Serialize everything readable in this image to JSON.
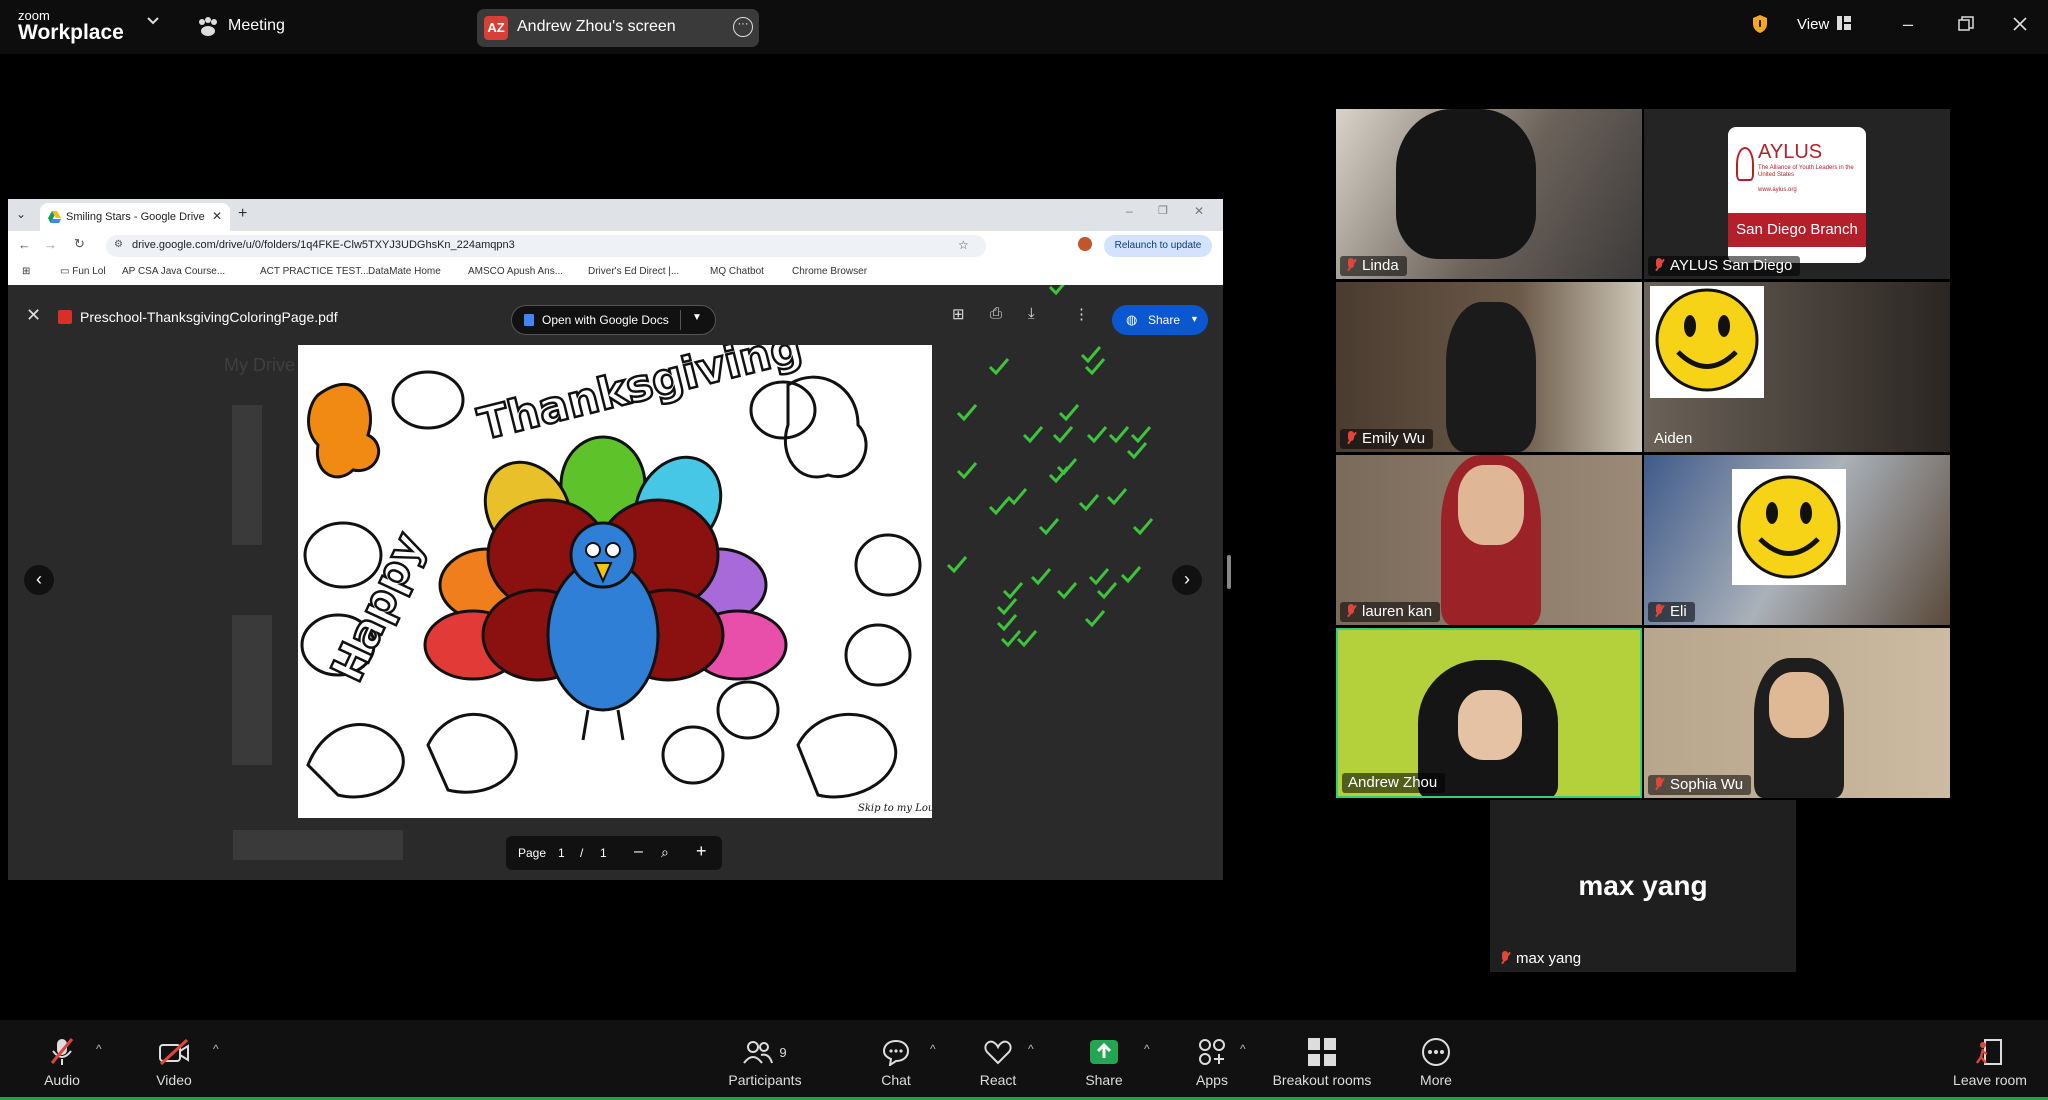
{
  "topbar": {
    "logo_small": "zoom",
    "logo_big": "Workplace",
    "meeting_label": "Meeting",
    "screen_badge": "AZ",
    "screen_label": "Andrew Zhou's screen",
    "view_label": "View"
  },
  "browser": {
    "tab_title": "Smiling Stars - Google Drive",
    "url": "drive.google.com/drive/u/0/folders/1q4FKE-Clw5TXYJ3UDGhsKn_224amqpn3",
    "relaunch": "Relaunch to update",
    "bookmarks": [
      "Fun Lol",
      "AP CSA Java Course...",
      "ACT PRACTICE TEST...",
      "DataMate Home",
      "AMSCO Apush Ans...",
      "Driver's Ed Direct |...",
      "MQ Chatbot",
      "Chrome Browser"
    ],
    "drive_bg_title": "My Drive"
  },
  "viewer": {
    "file_name": "Preschool-ThanksgivingColoringPage.pdf",
    "open_with": "Open with Google Docs",
    "share": "Share",
    "page_label": "Page",
    "page_current": "1",
    "page_sep": "/",
    "page_total": "1"
  },
  "coloring_page": {
    "word1": "Happy",
    "word2": "Thanksgiving",
    "signature": "Skip to my Lou"
  },
  "participants": [
    {
      "name": "Linda"
    },
    {
      "name": "AYLUS San Diego",
      "logo_title": "AYLUS",
      "logo_sub": "The Alliance of Youth Leaders in the United States",
      "logo_url": "www.aylus.org",
      "logo_branch": "San Diego Branch"
    },
    {
      "name": "Emily Wu"
    },
    {
      "name": "Aiden"
    },
    {
      "name": "lauren kan"
    },
    {
      "name": "Eli"
    },
    {
      "name": "Andrew Zhou"
    },
    {
      "name": "Sophia Wu"
    },
    {
      "name": "max yang",
      "big_name": "max yang"
    }
  ],
  "bottombar": {
    "audio": "Audio",
    "video": "Video",
    "participants": "Participants",
    "participant_count": "9",
    "chat": "Chat",
    "react": "React",
    "share": "Share",
    "apps": "Apps",
    "breakout": "Breakout rooms",
    "more": "More",
    "leave": "Leave room"
  },
  "colors": {
    "accent_green": "#24a148",
    "mute_red": "#e0463b",
    "share_green": "#23a552",
    "drive_blue": "#0b57d0",
    "active_speaker": "#2fd07b"
  }
}
